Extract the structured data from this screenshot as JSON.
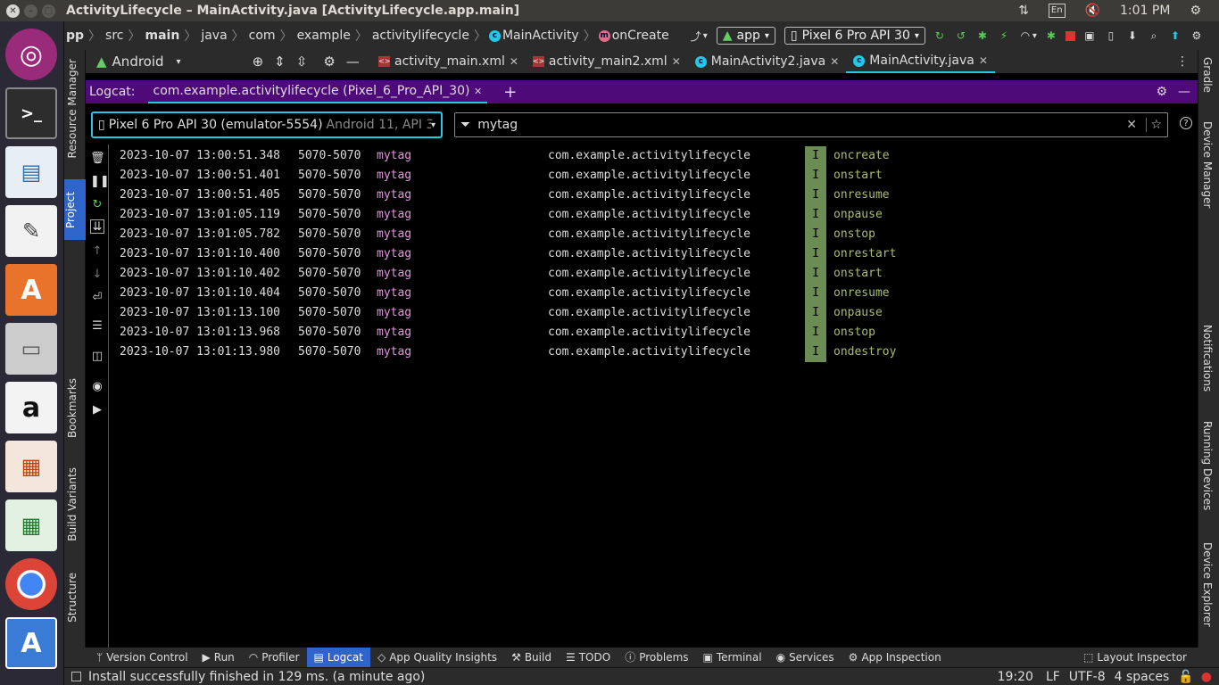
{
  "window": {
    "title": "ActivityLifecycle – MainActivity.java [ActivityLifecycle.app.main]"
  },
  "tray": {
    "input_method": "En",
    "time": "1:01 PM"
  },
  "launcher": {
    "items": [
      "ubuntu-dash",
      "terminal",
      "image-viewer",
      "text-editor",
      "software-center",
      "file-manager",
      "amazon",
      "impress",
      "calc",
      "chrome",
      "android-studio",
      "trash"
    ]
  },
  "breadcrumb": {
    "items": [
      "pp",
      "src",
      "main",
      "java",
      "com",
      "example",
      "activitylifecycle",
      "MainActivity",
      "onCreate"
    ],
    "run_config": "app",
    "device": "Pixel 6 Pro API 30"
  },
  "project_panel": {
    "view": "Android"
  },
  "editor_tabs": [
    {
      "label": "activity_main.xml",
      "active": false
    },
    {
      "label": "activity_main2.xml",
      "active": false
    },
    {
      "label": "MainActivity2.java",
      "active": false
    },
    {
      "label": "MainActivity.java",
      "active": true
    }
  ],
  "left_strip": {
    "resource_manager": "Resource Manager",
    "project": "Project",
    "bookmarks": "Bookmarks",
    "build_variants": "Build Variants",
    "structure": "Structure"
  },
  "right_strip": {
    "gradle": "Gradle",
    "device_manager": "Device Manager",
    "notifications": "Notifications",
    "running_devices": "Running Devices",
    "device_explorer": "Device Explorer"
  },
  "logcat": {
    "label": "Logcat:",
    "tab": "com.example.activitylifecycle (Pixel_6_Pro_API_30)",
    "device_name": "Pixel 6 Pro API 30 (emulator-5554)",
    "device_detail": "Android 11, API 3",
    "filter": "mytag",
    "rows": [
      {
        "ts": "2023-10-07 13:00:51.348",
        "pid": "5070-5070",
        "tag": "mytag",
        "pkg": "com.example.activitylifecycle",
        "lvl": "I",
        "msg": "oncreate"
      },
      {
        "ts": "2023-10-07 13:00:51.401",
        "pid": "5070-5070",
        "tag": "mytag",
        "pkg": "com.example.activitylifecycle",
        "lvl": "I",
        "msg": "onstart"
      },
      {
        "ts": "2023-10-07 13:00:51.405",
        "pid": "5070-5070",
        "tag": "mytag",
        "pkg": "com.example.activitylifecycle",
        "lvl": "I",
        "msg": "onresume"
      },
      {
        "ts": "2023-10-07 13:01:05.119",
        "pid": "5070-5070",
        "tag": "mytag",
        "pkg": "com.example.activitylifecycle",
        "lvl": "I",
        "msg": "onpause"
      },
      {
        "ts": "2023-10-07 13:01:05.782",
        "pid": "5070-5070",
        "tag": "mytag",
        "pkg": "com.example.activitylifecycle",
        "lvl": "I",
        "msg": "onstop"
      },
      {
        "ts": "2023-10-07 13:01:10.400",
        "pid": "5070-5070",
        "tag": "mytag",
        "pkg": "com.example.activitylifecycle",
        "lvl": "I",
        "msg": "onrestart"
      },
      {
        "ts": "2023-10-07 13:01:10.402",
        "pid": "5070-5070",
        "tag": "mytag",
        "pkg": "com.example.activitylifecycle",
        "lvl": "I",
        "msg": "onstart"
      },
      {
        "ts": "2023-10-07 13:01:10.404",
        "pid": "5070-5070",
        "tag": "mytag",
        "pkg": "com.example.activitylifecycle",
        "lvl": "I",
        "msg": "onresume"
      },
      {
        "ts": "2023-10-07 13:01:13.100",
        "pid": "5070-5070",
        "tag": "mytag",
        "pkg": "com.example.activitylifecycle",
        "lvl": "I",
        "msg": "onpause"
      },
      {
        "ts": "2023-10-07 13:01:13.968",
        "pid": "5070-5070",
        "tag": "mytag",
        "pkg": "com.example.activitylifecycle",
        "lvl": "I",
        "msg": "onstop"
      },
      {
        "ts": "2023-10-07 13:01:13.980",
        "pid": "5070-5070",
        "tag": "mytag",
        "pkg": "com.example.activitylifecycle",
        "lvl": "I",
        "msg": "ondestroy"
      }
    ]
  },
  "bottom_tools": [
    {
      "label": "Version Control",
      "icon": "branch-icon"
    },
    {
      "label": "Run",
      "icon": "play-icon"
    },
    {
      "label": "Profiler",
      "icon": "gauge-icon"
    },
    {
      "label": "Logcat",
      "icon": "logcat-icon",
      "active": true
    },
    {
      "label": "App Quality Insights",
      "icon": "diamond-icon"
    },
    {
      "label": "Build",
      "icon": "hammer-icon"
    },
    {
      "label": "TODO",
      "icon": "list-icon"
    },
    {
      "label": "Problems",
      "icon": "info-icon"
    },
    {
      "label": "Terminal",
      "icon": "terminal-icon"
    },
    {
      "label": "Services",
      "icon": "services-icon"
    },
    {
      "label": "App Inspection",
      "icon": "inspect-icon"
    },
    {
      "label": "Layout Inspector",
      "icon": "layout-icon"
    }
  ],
  "status": {
    "message": "Install successfully finished in 129 ms. (a minute ago)",
    "position": "19:20",
    "line_sep": "LF",
    "encoding": "UTF-8",
    "indent": "4 spaces"
  },
  "colors": {
    "accent": "#20c9e8",
    "logcat_header": "#4e0a79",
    "tag": "#e596df",
    "message": "#a9bd6e",
    "level_bg": "#6b8d53",
    "active_tool": "#2f65ca"
  }
}
